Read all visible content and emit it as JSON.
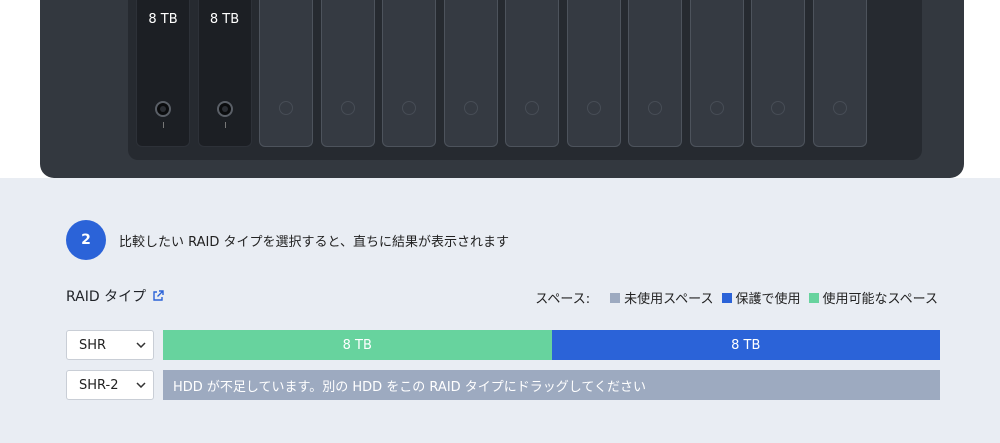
{
  "nas": {
    "bays": [
      {
        "filled": true,
        "capacity": "8 TB"
      },
      {
        "filled": true,
        "capacity": "8 TB"
      },
      {
        "filled": false
      },
      {
        "filled": false
      },
      {
        "filled": false
      },
      {
        "filled": false
      },
      {
        "filled": false
      },
      {
        "filled": false
      },
      {
        "filled": false
      },
      {
        "filled": false
      },
      {
        "filled": false
      },
      {
        "filled": false
      }
    ]
  },
  "step": {
    "number": "2",
    "instruction": "比較したい RAID タイプを選択すると、直ちに結果が表示されます"
  },
  "raid_section": {
    "title": "RAID タイプ",
    "link_icon": "external-link-icon"
  },
  "legend": {
    "label": "スペース:",
    "items": [
      {
        "label": "未使用スペース",
        "color": "#9daac0"
      },
      {
        "label": "保護で使用",
        "color": "#2b63d8"
      },
      {
        "label": "使用可能なスペース",
        "color": "#67d39e"
      }
    ]
  },
  "rows": [
    {
      "raid_type": "SHR",
      "segments": [
        {
          "label": "8 TB",
          "kind": "available",
          "color": "#67d39e",
          "fraction": 0.5
        },
        {
          "label": "8 TB",
          "kind": "protection",
          "color": "#2b63d8",
          "fraction": 0.5
        }
      ]
    },
    {
      "raid_type": "SHR-2",
      "message": "HDD が不足しています。別の HDD をこの RAID タイプにドラッグしてください"
    }
  ]
}
